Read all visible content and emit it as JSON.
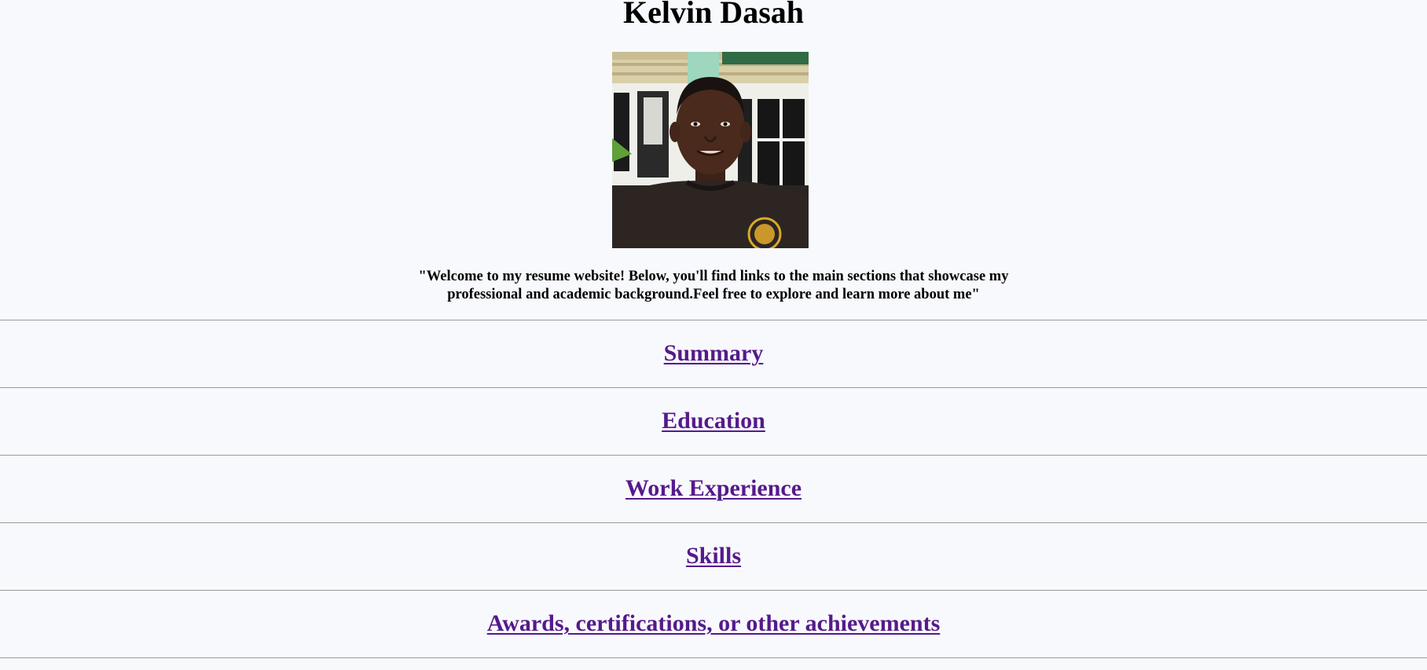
{
  "header": {
    "name": "Kelvin Dasah"
  },
  "profile": {
    "photo_icon": "profile-photo"
  },
  "intro": {
    "welcome_text": "\"Welcome to my resume website! Below, you'll find links to the main sections that showcase my professional and academic background.Feel free to explore and learn more about me\""
  },
  "nav": {
    "links": [
      {
        "label": "Summary"
      },
      {
        "label": "Education"
      },
      {
        "label": "Work Experience"
      },
      {
        "label": "Skills"
      },
      {
        "label": "Awards, certifications, or other achievements"
      }
    ]
  },
  "colors": {
    "background": "#f8f9fd",
    "visited_link": "#551a8b",
    "divider": "#9a9a9a"
  }
}
